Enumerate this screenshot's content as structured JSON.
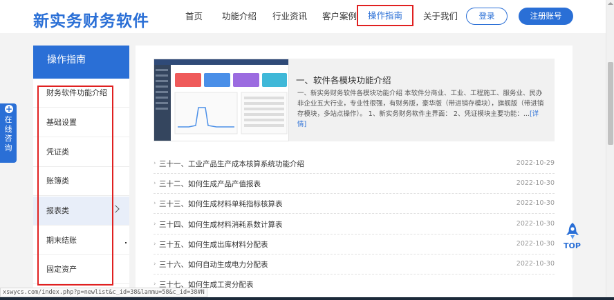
{
  "header": {
    "logo": "新实务财务软件",
    "nav": [
      "首页",
      "功能介绍",
      "行业资讯",
      "客户案例",
      "操作指南",
      "关于我们"
    ],
    "active_nav": "操作指南",
    "login_label": "登录",
    "register_label": "注册账号",
    "accent": "#2a6fd6"
  },
  "sidebar": {
    "title": "操作指南",
    "items": [
      {
        "label": "财务软件功能介绍"
      },
      {
        "label": "基础设置"
      },
      {
        "label": "凭证类"
      },
      {
        "label": "账簿类"
      },
      {
        "label": "报表类",
        "active": true
      },
      {
        "label": "期末结账"
      },
      {
        "label": "固定资产"
      }
    ]
  },
  "consult": {
    "label": "在线咨询"
  },
  "feature": {
    "title": "一、软件各模块功能介绍",
    "desc": "一、新实务财务软件各模块功能介绍 本软件分商业、工业、工程施工、服务业、民办非企业五大行业，专业性很强，有财务版，豪华版（带进销存模块），旗舰版（带进销存模块，多站点操作）。 1、新实务财务软件主界面： 2、凭证模块主要功能：...",
    "more": "[详情]"
  },
  "articles": [
    {
      "title": "三十一、工业产品生产成本核算系统功能介绍",
      "date": "2022-10-29"
    },
    {
      "title": "三十二、如何生成产品产值报表",
      "date": "2022-10-30"
    },
    {
      "title": "三十三、如何生成材料单耗指标核算表",
      "date": "2022-10-30"
    },
    {
      "title": "三十四、如何生成材料消耗系数计算表",
      "date": "2022-10-30"
    },
    {
      "title": "三十五、如何生成出库材料分配表",
      "date": "2022-10-30"
    },
    {
      "title": "三十六、如何自动生成电力分配表",
      "date": "2022-10-30"
    },
    {
      "title": "三十七、如何生成工资分配表",
      "date": ""
    }
  ],
  "top_button": {
    "label": "TOP"
  },
  "status_bar": {
    "url": "xswycs.com/index.php?p=newlist&c_id=38&lanmu=58&c_id=38#N"
  }
}
